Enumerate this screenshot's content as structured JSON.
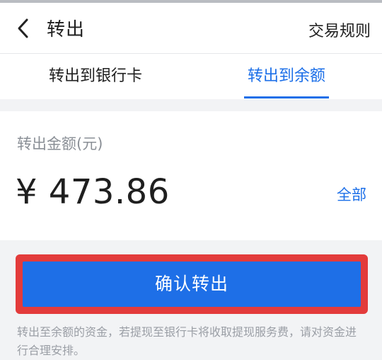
{
  "header": {
    "title": "转出",
    "rules_link": "交易规则",
    "back_icon": "chevron-left-icon"
  },
  "tabs": [
    {
      "label": "转出到银行卡",
      "active": false
    },
    {
      "label": "转出到余额",
      "active": true
    }
  ],
  "amount": {
    "label": "转出金额(元)",
    "value": "¥ 473.86",
    "all_label": "全部"
  },
  "confirm": {
    "label": "确认转出"
  },
  "note": {
    "text": "转出至余额的资金，若提现至银行卡将收取提现服务费，请对资金进行合理安排。"
  },
  "colors": {
    "accent": "#1c6fe8",
    "highlight_border": "#e33b3b"
  }
}
